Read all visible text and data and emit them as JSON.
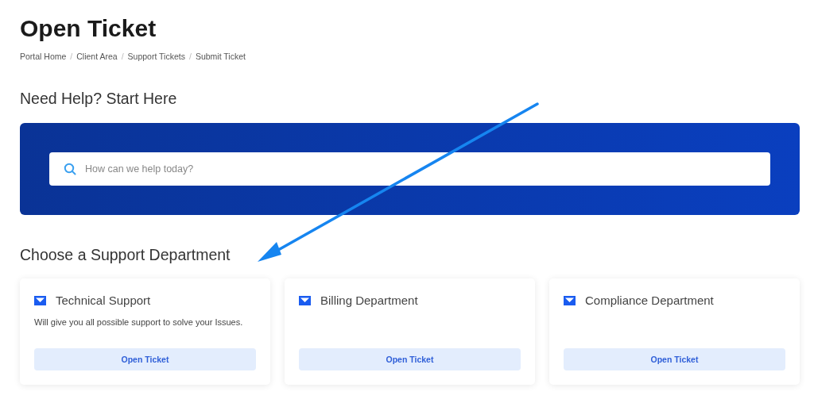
{
  "page_title": "Open Ticket",
  "breadcrumb_separator": "/",
  "breadcrumb": [
    "Portal Home",
    "Client Area",
    "Support Tickets",
    "Submit Ticket"
  ],
  "help_heading": "Need Help? Start Here",
  "search": {
    "placeholder": "How can we help today?"
  },
  "departments_heading": "Choose a Support Department",
  "departments": [
    {
      "name": "Technical Support",
      "description": "Will give you all possible support to solve your Issues.",
      "button": "Open Ticket"
    },
    {
      "name": "Billing Department",
      "button": "Open Ticket"
    },
    {
      "name": "Compliance Department",
      "button": "Open Ticket"
    }
  ]
}
